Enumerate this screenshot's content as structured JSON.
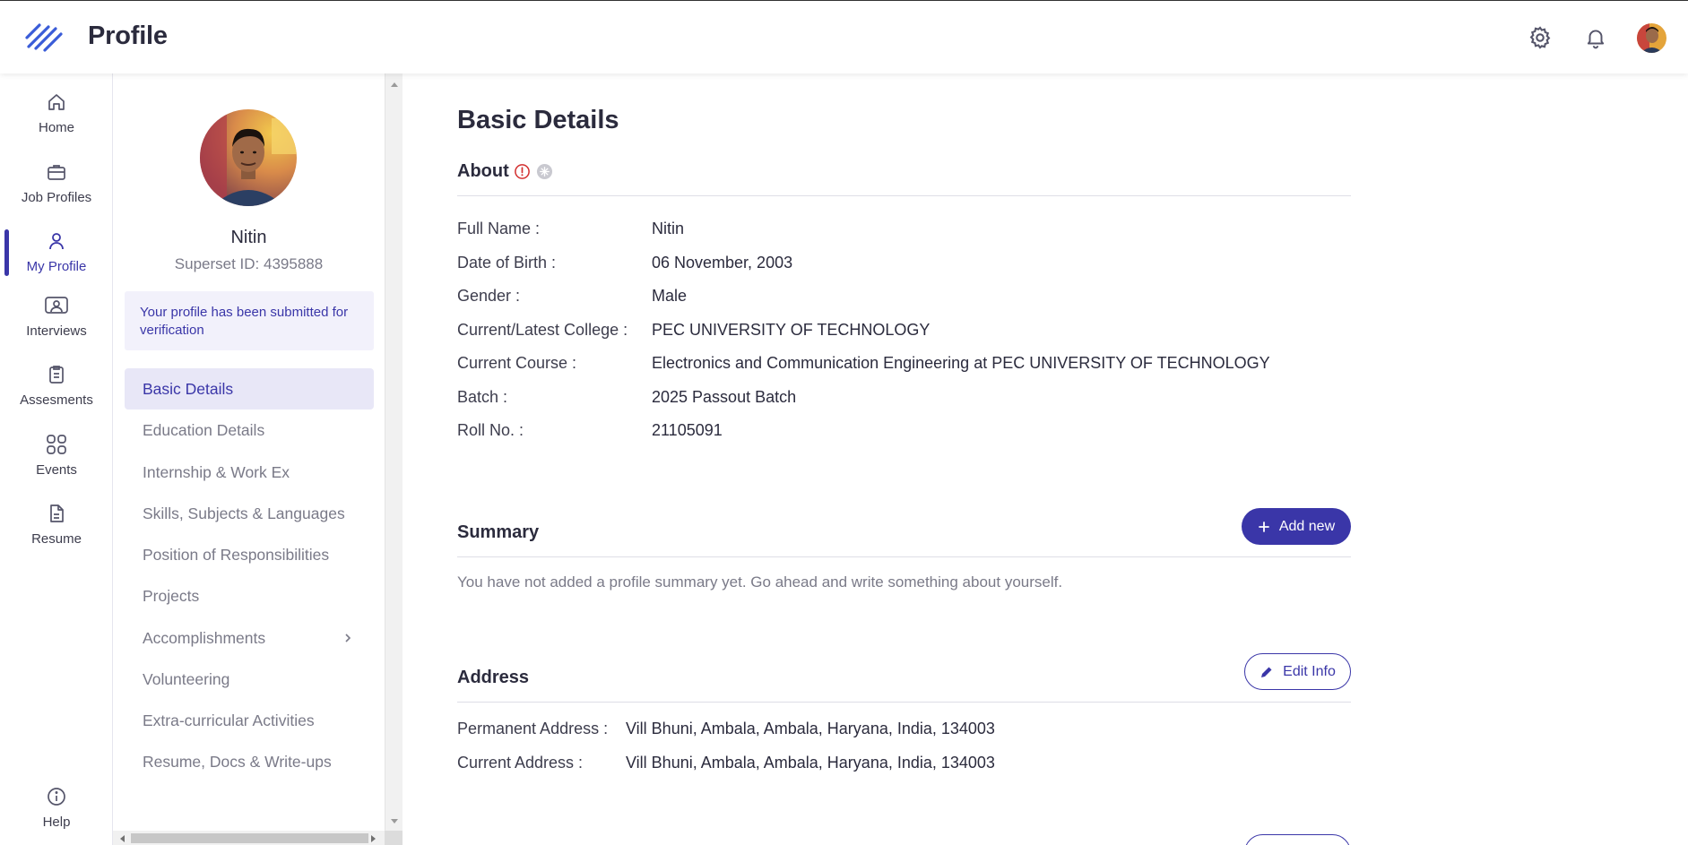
{
  "header": {
    "title": "Profile"
  },
  "rail": {
    "items": [
      {
        "label": "Home",
        "icon": "home-icon"
      },
      {
        "label": "Job Profiles",
        "icon": "briefcase-icon"
      },
      {
        "label": "My Profile",
        "icon": "user-icon",
        "active": true
      },
      {
        "label": "Interviews",
        "icon": "interview-icon"
      },
      {
        "label": "Assesments",
        "icon": "clipboard-icon"
      },
      {
        "label": "Events",
        "icon": "grid-icon"
      },
      {
        "label": "Resume",
        "icon": "document-icon"
      }
    ],
    "help": {
      "label": "Help",
      "icon": "info-icon"
    }
  },
  "profile": {
    "name": "Nitin",
    "superset_id": "Superset ID: 4395888",
    "verification_message": "Your profile has been submitted for verification"
  },
  "menu": {
    "items": [
      {
        "label": "Basic Details",
        "active": true
      },
      {
        "label": "Education Details"
      },
      {
        "label": "Internship & Work Ex"
      },
      {
        "label": "Skills, Subjects & Languages"
      },
      {
        "label": "Position of Responsibilities"
      },
      {
        "label": "Projects"
      },
      {
        "label": "Accomplishments",
        "has_submenu": true
      },
      {
        "label": "Volunteering"
      },
      {
        "label": "Extra-curricular Activities"
      },
      {
        "label": "Resume, Docs & Write-ups"
      }
    ]
  },
  "main": {
    "heading": "Basic Details",
    "about": {
      "title": "About",
      "fields": [
        {
          "label": "Full Name :",
          "value": "Nitin"
        },
        {
          "label": "Date of Birth :",
          "value": "06 November, 2003"
        },
        {
          "label": "Gender :",
          "value": "Male"
        },
        {
          "label": "Current/Latest College :",
          "value": "PEC UNIVERSITY OF TECHNOLOGY"
        },
        {
          "label": "Current Course :",
          "value": "Electronics and Communication Engineering at PEC UNIVERSITY OF TECHNOLOGY"
        },
        {
          "label": "Batch :",
          "value": "2025 Passout Batch"
        },
        {
          "label": "Roll No. :",
          "value": "21105091"
        }
      ]
    },
    "summary": {
      "title": "Summary",
      "add_button": "Add new",
      "empty_text": "You have not added a profile summary yet. Go ahead and write something about yourself."
    },
    "address": {
      "title": "Address",
      "edit_button": "Edit Info",
      "fields": [
        {
          "label": "Permanent Address :",
          "value": "Vill Bhuni, Ambala, Ambala, Haryana, India, 134003"
        },
        {
          "label": "Current Address :",
          "value": "Vill Bhuni, Ambala, Ambala, Haryana, India, 134003"
        }
      ]
    }
  },
  "colors": {
    "accent": "#3a36a8",
    "warning": "#d32f2f",
    "muted": "#7a7a88"
  }
}
